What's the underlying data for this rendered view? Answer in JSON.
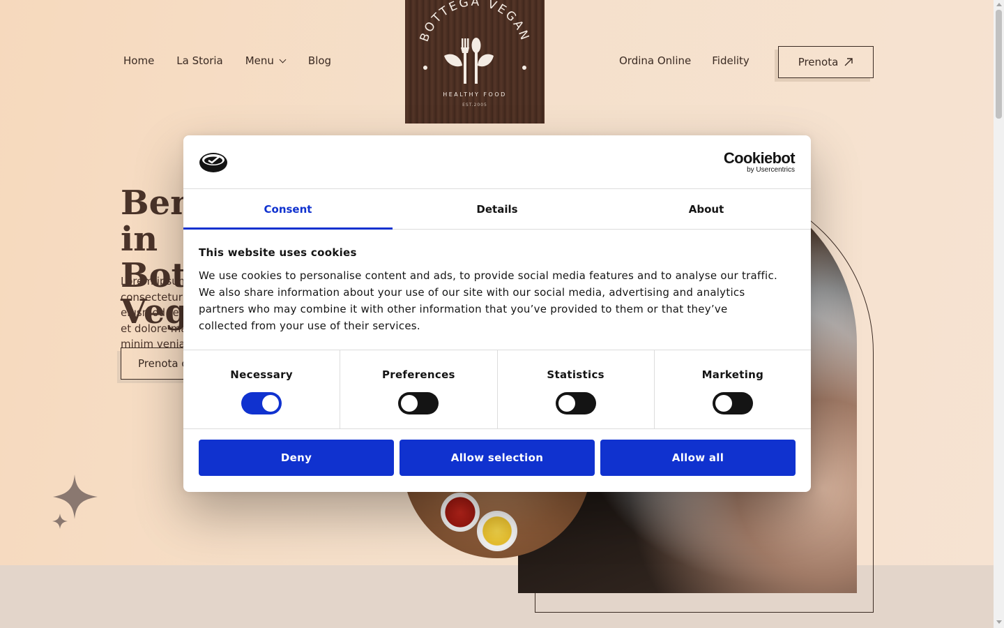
{
  "header": {
    "nav_left": [
      "Home",
      "La Storia",
      "Menu",
      "Blog"
    ],
    "nav_right": [
      "Ordina Online",
      "Fidelity"
    ],
    "cta_label": "Prenota",
    "cta_icon": "arrow-up-right-icon",
    "logo": {
      "name": "BOTTEGA VEGAN",
      "tagline": "HEALTHY FOOD",
      "est": "EST.2005"
    }
  },
  "hero": {
    "title": "Benvenuti in\nBottega Vegan",
    "text": "Lorem ipsum dolor sit amet, consectetur adipiscing elit, sed do eiusmod tempor incididunt ut labore et dolore magna aliqua. Ut enim ad minim veniam",
    "button_label": "Prenota ora"
  },
  "cookie_dialog": {
    "brand": "Cookiebot",
    "brand_sub": "by Usercentrics",
    "tabs": [
      "Consent",
      "Details",
      "About"
    ],
    "active_tab": "Consent",
    "heading": "This website uses cookies",
    "body": "We use cookies to personalise content and ads, to provide social media features and to analyse our traffic. We also share information about your use of our site with our social media, advertising and analytics partners who may combine it with other information that you’ve provided to them or that they’ve collected from your use of their services.",
    "toggles": [
      {
        "label": "Necessary",
        "on": true
      },
      {
        "label": "Preferences",
        "on": false
      },
      {
        "label": "Statistics",
        "on": false
      },
      {
        "label": "Marketing",
        "on": false
      }
    ],
    "buttons": {
      "deny": "Deny",
      "allow_selection": "Allow selection",
      "allow_all": "Allow all"
    }
  },
  "colors": {
    "accent": "#1032cf",
    "text_dark": "#3a2a22",
    "background": "#f6dfc8"
  }
}
